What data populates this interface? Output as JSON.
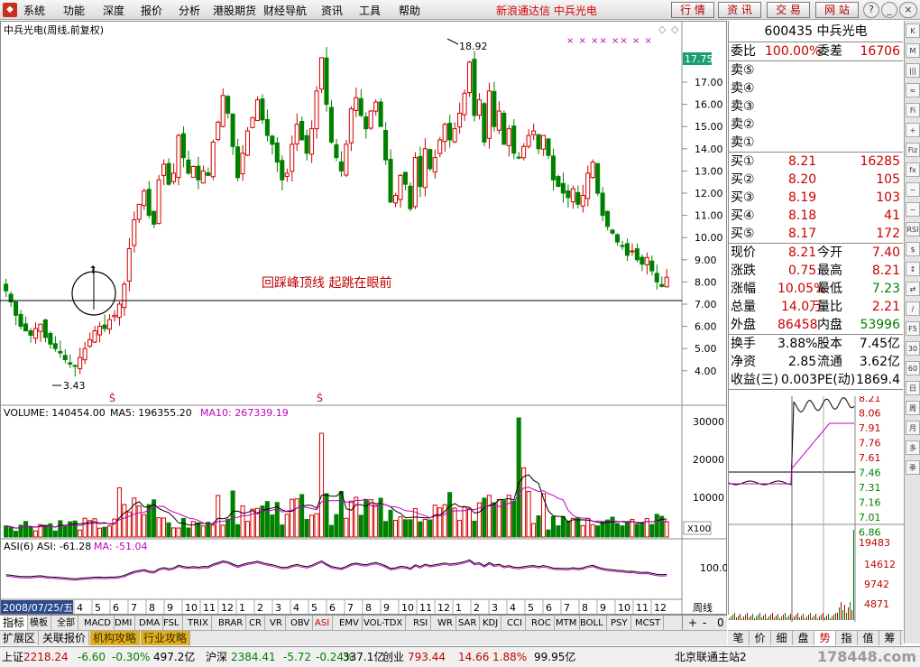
{
  "menubar": {
    "items": [
      "系统",
      "功能",
      "深度",
      "报价",
      "分析",
      "港股期货",
      "财经导航",
      "资讯",
      "工具",
      "帮助"
    ],
    "brand": "新浪通达信  中兵光电",
    "buttons": [
      "行 情",
      "资 讯",
      "交 易",
      "网 站"
    ],
    "window_controls": [
      "?",
      "_",
      "□",
      "×"
    ]
  },
  "chart": {
    "title": "中兵光电(周线,前复权)",
    "current_price_label": "17.75",
    "high_marker": "18.92",
    "low_marker": "3.43",
    "annotation": "回踩峰顶线  起跳在眼前",
    "price_axis": [
      "17.00",
      "16.00",
      "15.00",
      "14.00",
      "13.00",
      "12.00",
      "11.00",
      "10.00",
      "9.00",
      "8.00",
      "7.00",
      "6.00",
      "5.00",
      "4.00"
    ],
    "volume_label": "VOLUME: 140454.00",
    "ma5_label": "MA5: 196355.20",
    "ma10_label": "MA10: 267339.19",
    "volume_axis": [
      "30000",
      "20000",
      "10000"
    ],
    "volume_unit": "X100",
    "asi_label": "ASI(6)  ASI: -61.28",
    "asi_ma_label": "MA: -51.04",
    "asi_axis": "100.0",
    "date_label": "2008/07/25/五",
    "month_ticks": [
      "1",
      "2",
      "3",
      "4",
      "5",
      "6",
      "7",
      "8",
      "9",
      "10",
      "11",
      "12",
      "1",
      "2",
      "3",
      "4",
      "5",
      "6",
      "7",
      "8",
      "9",
      "10",
      "11",
      "12",
      "1",
      "2",
      "3",
      "4",
      "5",
      "6",
      "7",
      "8",
      "9",
      "10",
      "11",
      "12"
    ],
    "period_label": "周线",
    "period_controls": [
      "+",
      "-",
      "0"
    ],
    "colors": {
      "up": "#d00000",
      "down": "#008000",
      "ma5": "#000000",
      "ma10": "#c000c0"
    }
  },
  "chart_data": {
    "type": "candlestick",
    "title": "中兵光电(周线,前复权)",
    "high": 18.92,
    "low": 3.43,
    "ylim": [
      3.3,
      19.6
    ],
    "support_line": 7.25,
    "close": [
      7.6,
      7.1,
      6.5,
      6.0,
      5.8,
      5.6,
      5.9,
      6.1,
      5.5,
      5.2,
      5.0,
      4.8,
      4.5,
      4.3,
      4.2,
      4.6,
      5.0,
      5.4,
      5.8,
      6.0,
      5.9,
      6.3,
      6.5,
      7.0,
      7.9,
      9.5,
      10.8,
      11.5,
      12.1,
      11.0,
      10.6,
      12.6,
      13.3,
      12.4,
      12.9,
      14.6,
      13.6,
      12.9,
      13.2,
      12.6,
      13.0,
      12.8,
      14.3,
      15.2,
      16.4,
      15.6,
      14.1,
      12.7,
      13.8,
      14.8,
      15.4,
      16.2,
      15.3,
      14.6,
      14.2,
      13.4,
      12.6,
      12.9,
      14.2,
      15.1,
      14.4,
      13.8,
      14.9,
      16.6,
      18.1,
      16.0,
      14.3,
      13.6,
      13.0,
      14.2,
      15.8,
      16.3,
      15.5,
      14.9,
      15.7,
      16.1,
      15.0,
      13.5,
      11.6,
      11.9,
      12.8,
      12.4,
      11.3,
      13.6,
      12.3,
      14.0,
      13.1,
      13.6,
      14.4,
      15.1,
      14.4,
      14.9,
      15.6,
      16.5,
      17.9,
      15.5,
      16.2,
      14.3,
      16.6,
      15.0,
      15.7,
      14.2,
      14.9,
      13.8,
      13.6,
      14.1,
      14.6,
      14.8,
      14.0,
      14.6,
      13.7,
      12.6,
      12.3,
      12.0,
      11.8,
      12.2,
      11.5,
      11.9,
      12.9,
      13.4,
      12.0,
      11.0,
      10.5,
      10.2,
      9.8,
      9.6,
      9.2,
      9.4,
      9.0,
      8.8,
      9.1,
      8.5,
      8.0,
      7.8,
      8.21
    ],
    "volume_peak": 31000
  },
  "quote": {
    "code_name": "600435 中兵光电",
    "weibi_label": "委比",
    "weibi_value": "100.00%",
    "weicha_label": "委差",
    "weicha_value": "16706",
    "sell": [
      {
        "label": "卖⑤"
      },
      {
        "label": "卖④"
      },
      {
        "label": "卖③"
      },
      {
        "label": "卖②"
      },
      {
        "label": "卖①"
      }
    ],
    "buy": [
      {
        "label": "买①",
        "price": "8.21",
        "vol": "16285"
      },
      {
        "label": "买②",
        "price": "8.20",
        "vol": "105"
      },
      {
        "label": "买③",
        "price": "8.19",
        "vol": "103"
      },
      {
        "label": "买④",
        "price": "8.18",
        "vol": "41"
      },
      {
        "label": "买⑤",
        "price": "8.17",
        "vol": "172"
      }
    ],
    "stats": [
      {
        "l1": "现价",
        "v1": "8.21",
        "l2": "今开",
        "v2": "7.40"
      },
      {
        "l1": "涨跌",
        "v1": "0.75",
        "l2": "最高",
        "v2": "8.21"
      },
      {
        "l1": "涨幅",
        "v1": "10.05%",
        "l2": "最低",
        "v2": "7.23"
      },
      {
        "l1": "总量",
        "v1": "14.0万",
        "l2": "量比",
        "v2": "2.21"
      },
      {
        "l1": "外盘",
        "v1": "86458",
        "l2": "内盘",
        "v2": "53996"
      }
    ],
    "stats2": [
      {
        "l1": "换手",
        "v1": "3.88%",
        "l2": "股本",
        "v2": "7.45亿"
      },
      {
        "l1": "净资",
        "v1": "2.85",
        "l2": "流通",
        "v2": "3.62亿"
      },
      {
        "l1": "收益(三)",
        "v1": "0.003",
        "l2": "PE(动)",
        "v2": "1869.4"
      }
    ],
    "mini_axis": [
      "8.21",
      "8.06",
      "7.91",
      "7.76",
      "7.61",
      "7.46",
      "7.31",
      "7.16",
      "7.01",
      "6.86"
    ],
    "mini_vol_axis": [
      "19483",
      "14612",
      "9742",
      "4871"
    ],
    "tabs": [
      "笔",
      "价",
      "细",
      "盘",
      "势",
      "指",
      "值",
      "筹"
    ]
  },
  "side_tools": [
    "K",
    "M",
    "|||",
    "≈",
    "Fi",
    "+",
    "Fiz",
    "fx",
    "~",
    "~",
    "RSI",
    "$",
    "↕",
    "⇄",
    "/",
    "F5",
    "30",
    "60",
    "日",
    "周",
    "月",
    "多",
    "季"
  ],
  "tabs": [
    "指标",
    "模板",
    "全部",
    "MACD",
    "DMI",
    "DMA",
    "FSL",
    "TRIX",
    "BRAR",
    "CR",
    "VR",
    "OBV",
    "ASI",
    "EMV",
    "VOL-TDX",
    "RSI",
    "WR",
    "SAR",
    "KDJ",
    "CCI",
    "ROC",
    "MTM",
    "BOLL",
    "PSY",
    "MCST"
  ],
  "tabs2": [
    "扩展区",
    "关联报价",
    "机构攻略",
    "行业攻略"
  ],
  "status": {
    "sh_label": "上证",
    "sh_value": "2218.24",
    "sh_change": "-6.60",
    "sh_pct": "-0.30%",
    "sh_amount": "497.2亿",
    "sz_label": "沪深",
    "sz_value": "2384.41",
    "sz_change": "-5.72",
    "sz_pct": "-0.24%",
    "sz_amount": "337.1亿",
    "cy_label": "创业",
    "cy_value": "793.44",
    "cy_change": "14.66",
    "cy_pct": "1.88%",
    "cy_amount": "99.95亿",
    "server": "北京联通主站2",
    "watermark": "178448.com"
  }
}
